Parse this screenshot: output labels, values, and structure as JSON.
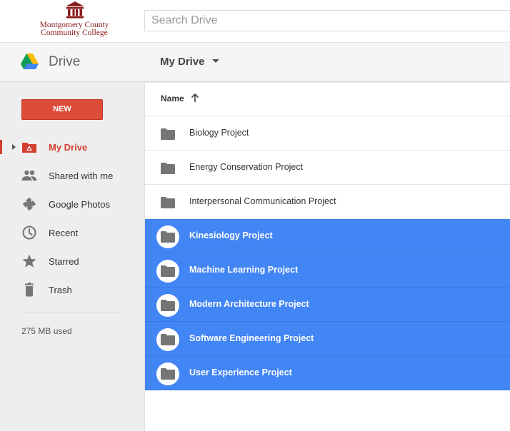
{
  "brand": {
    "line1": "Montgomery County",
    "line2": "Community College"
  },
  "search": {
    "placeholder": "Search Drive",
    "value": ""
  },
  "header": {
    "app_title": "Drive",
    "location_menu": "My Drive"
  },
  "sidebar": {
    "new_label": "NEW",
    "items": [
      {
        "label": "My Drive",
        "icon": "my-drive-icon",
        "active": true
      },
      {
        "label": "Shared with me",
        "icon": "people-icon",
        "active": false
      },
      {
        "label": "Google Photos",
        "icon": "pinwheel-icon",
        "active": false
      },
      {
        "label": "Recent",
        "icon": "clock-icon",
        "active": false
      },
      {
        "label": "Starred",
        "icon": "star-icon",
        "active": false
      },
      {
        "label": "Trash",
        "icon": "trash-icon",
        "active": false
      }
    ],
    "storage": "275 MB used"
  },
  "list": {
    "column_name": "Name",
    "sort": "ascending",
    "rows": [
      {
        "name": "Biology Project",
        "selected": false
      },
      {
        "name": "Energy Conservation Project",
        "selected": false
      },
      {
        "name": "Interpersonal Communication Project",
        "selected": false
      },
      {
        "name": "Kinesiology Project",
        "selected": true
      },
      {
        "name": "Machine Learning Project",
        "selected": true
      },
      {
        "name": "Modern Architecture Project",
        "selected": true
      },
      {
        "name": "Software Engineering Project",
        "selected": true
      },
      {
        "name": "User Experience Project",
        "selected": true
      }
    ]
  },
  "colors": {
    "brand": "#8a1b1b",
    "new_button": "#dd4b39",
    "active_nav": "#d23f31",
    "selection": "#4285f4",
    "icon_grey": "#757575"
  }
}
